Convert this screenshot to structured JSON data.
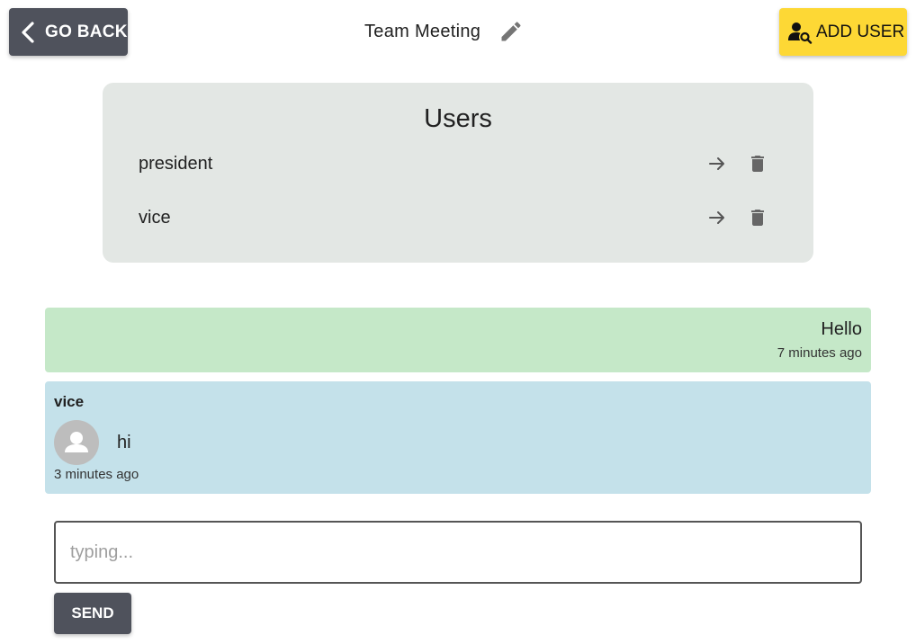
{
  "header": {
    "back_label": "GO BACK",
    "title": "Team Meeting",
    "add_user_label": "ADD USER"
  },
  "users_panel": {
    "title": "Users",
    "users": [
      {
        "name": "president"
      },
      {
        "name": "vice"
      }
    ]
  },
  "messages": [
    {
      "sender": "",
      "text": "Hello",
      "time": "7 minutes ago",
      "own": true
    },
    {
      "sender": "vice",
      "text": "hi",
      "time": "3 minutes ago",
      "own": false
    }
  ],
  "composer": {
    "placeholder": "typing...",
    "value": "",
    "send_label": "SEND"
  },
  "colors": {
    "dark_button": "#4f525c",
    "accent_yellow": "#fdd835",
    "panel_gray": "#e3e7e4",
    "own_message": "#c5e8c8",
    "other_message": "#c4e1ea"
  },
  "icons": [
    "chevron-left-icon",
    "pencil-icon",
    "person-search-icon",
    "arrow-right-icon",
    "trash-icon",
    "person-icon"
  ]
}
